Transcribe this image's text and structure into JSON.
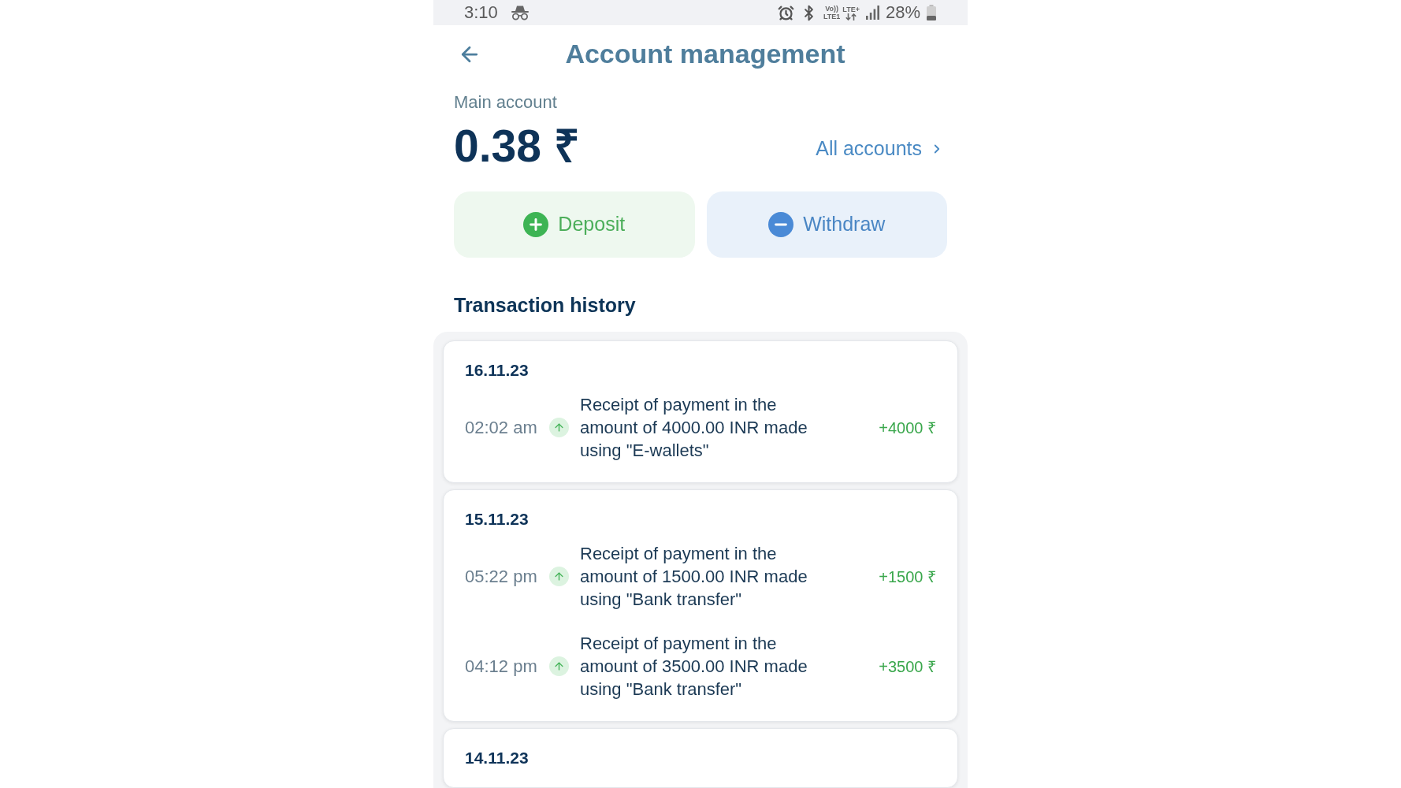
{
  "status_bar": {
    "time": "3:10",
    "network": {
      "voice": "Vo))",
      "sim": "LTE1",
      "type": "LTE+"
    },
    "battery": "28%"
  },
  "header": {
    "title": "Account management"
  },
  "account": {
    "label": "Main account",
    "balance": "0.38 ₹",
    "link": "All accounts"
  },
  "actions": [
    {
      "kind": "deposit",
      "label": "Deposit"
    },
    {
      "kind": "withdraw",
      "label": "Withdraw"
    }
  ],
  "history": {
    "title": "Transaction history",
    "groups": [
      {
        "date": "16.11.23",
        "transactions": [
          {
            "kind": "incoming",
            "time": "02:02 am",
            "description": "Receipt of payment in the amount of 4000.00 INR made using \"E-wallets\"",
            "amount": "+4000 ₹"
          }
        ]
      },
      {
        "date": "15.11.23",
        "transactions": [
          {
            "kind": "incoming",
            "time": "05:22 pm",
            "description": "Receipt of payment in the amount of 1500.00 INR made using \"Bank transfer\"",
            "amount": "+1500 ₹"
          },
          {
            "kind": "incoming",
            "time": "04:12 pm",
            "description": "Receipt of payment in the amount of 3500.00 INR made using \"Bank transfer\"",
            "amount": "+3500 ₹"
          }
        ]
      },
      {
        "date": "14.11.23"
      }
    ]
  }
}
